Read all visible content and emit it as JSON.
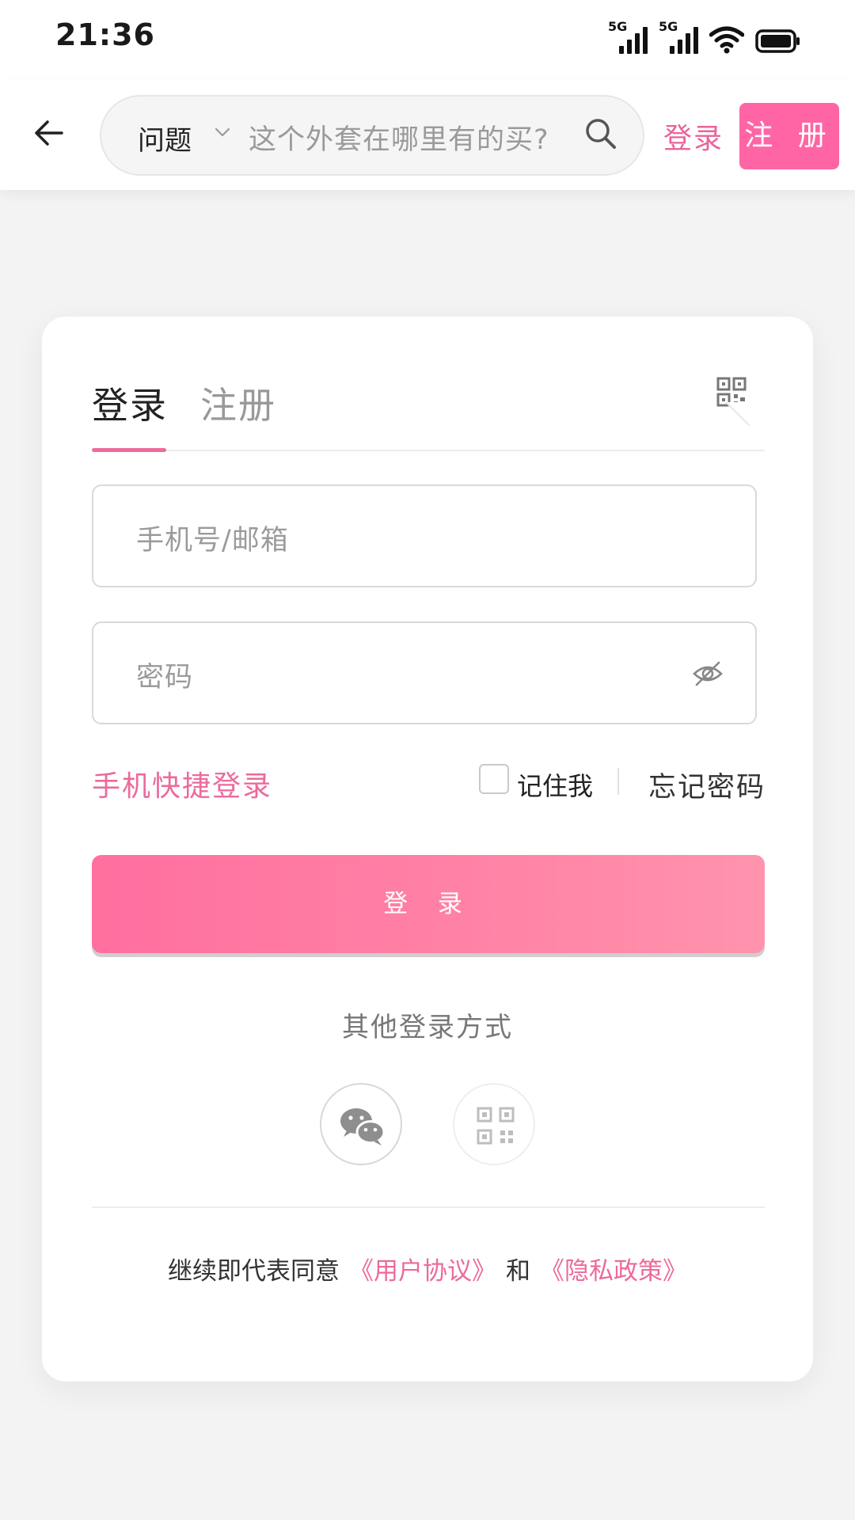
{
  "status_bar": {
    "time": "21:36",
    "signal_1_label": "5G",
    "signal_2_label": "5G",
    "icons": [
      "signal-icon",
      "signal-icon",
      "wifi-icon",
      "battery-icon"
    ]
  },
  "header": {
    "search_type": "问题",
    "search_placeholder": "这个外套在哪里有的买?",
    "login_label": "登录",
    "register_label": "注 册"
  },
  "card": {
    "tabs": [
      {
        "label": "登录",
        "active": true
      },
      {
        "label": "注册",
        "active": false
      }
    ],
    "phone_placeholder": "手机号/邮箱",
    "password_placeholder": "密码",
    "quick_login": "手机快捷登录",
    "remember_me": "记住我",
    "forgot_password": "忘记密码",
    "login_button": "登 录",
    "other_methods_title": "其他登录方式",
    "other_methods": [
      "wechat-icon",
      "qr-code-icon"
    ],
    "agreement": {
      "prefix": "继续即代表同意",
      "user_agreement": "《用户协议》",
      "and": "和",
      "privacy_policy": "《隐私政策》"
    }
  },
  "colors": {
    "accent": "#ee6b9c",
    "register_button": "#ff65a4",
    "login_gradient_start": "#ff6f9f",
    "login_gradient_end": "#ff93ad"
  }
}
